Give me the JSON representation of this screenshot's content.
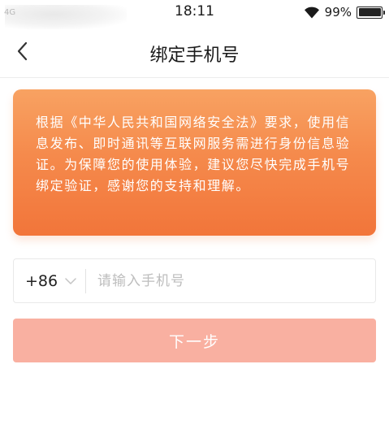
{
  "status_bar": {
    "network": "4G",
    "time": "18:11",
    "battery": "99%",
    "icons": [
      "wifi-icon",
      "battery-icon"
    ]
  },
  "nav": {
    "title": "绑定手机号",
    "back_icon": "chevron-left-icon"
  },
  "notice": {
    "text": "根据《中华人民共和国网络安全法》要求，使用信息发布、即时通讯等互联网服务需进行身份信息验证。为保障您的使用体验，建议您尽快完成手机号绑定验证，感谢您的支持和理解。",
    "gradient_colors": [
      "#f8a262",
      "#f2753a"
    ]
  },
  "phone_field": {
    "country_code": "+86",
    "value": "",
    "placeholder": "请输入手机号"
  },
  "next_button": {
    "label": "下一步",
    "color": "#f9b0a1",
    "enabled": false
  }
}
